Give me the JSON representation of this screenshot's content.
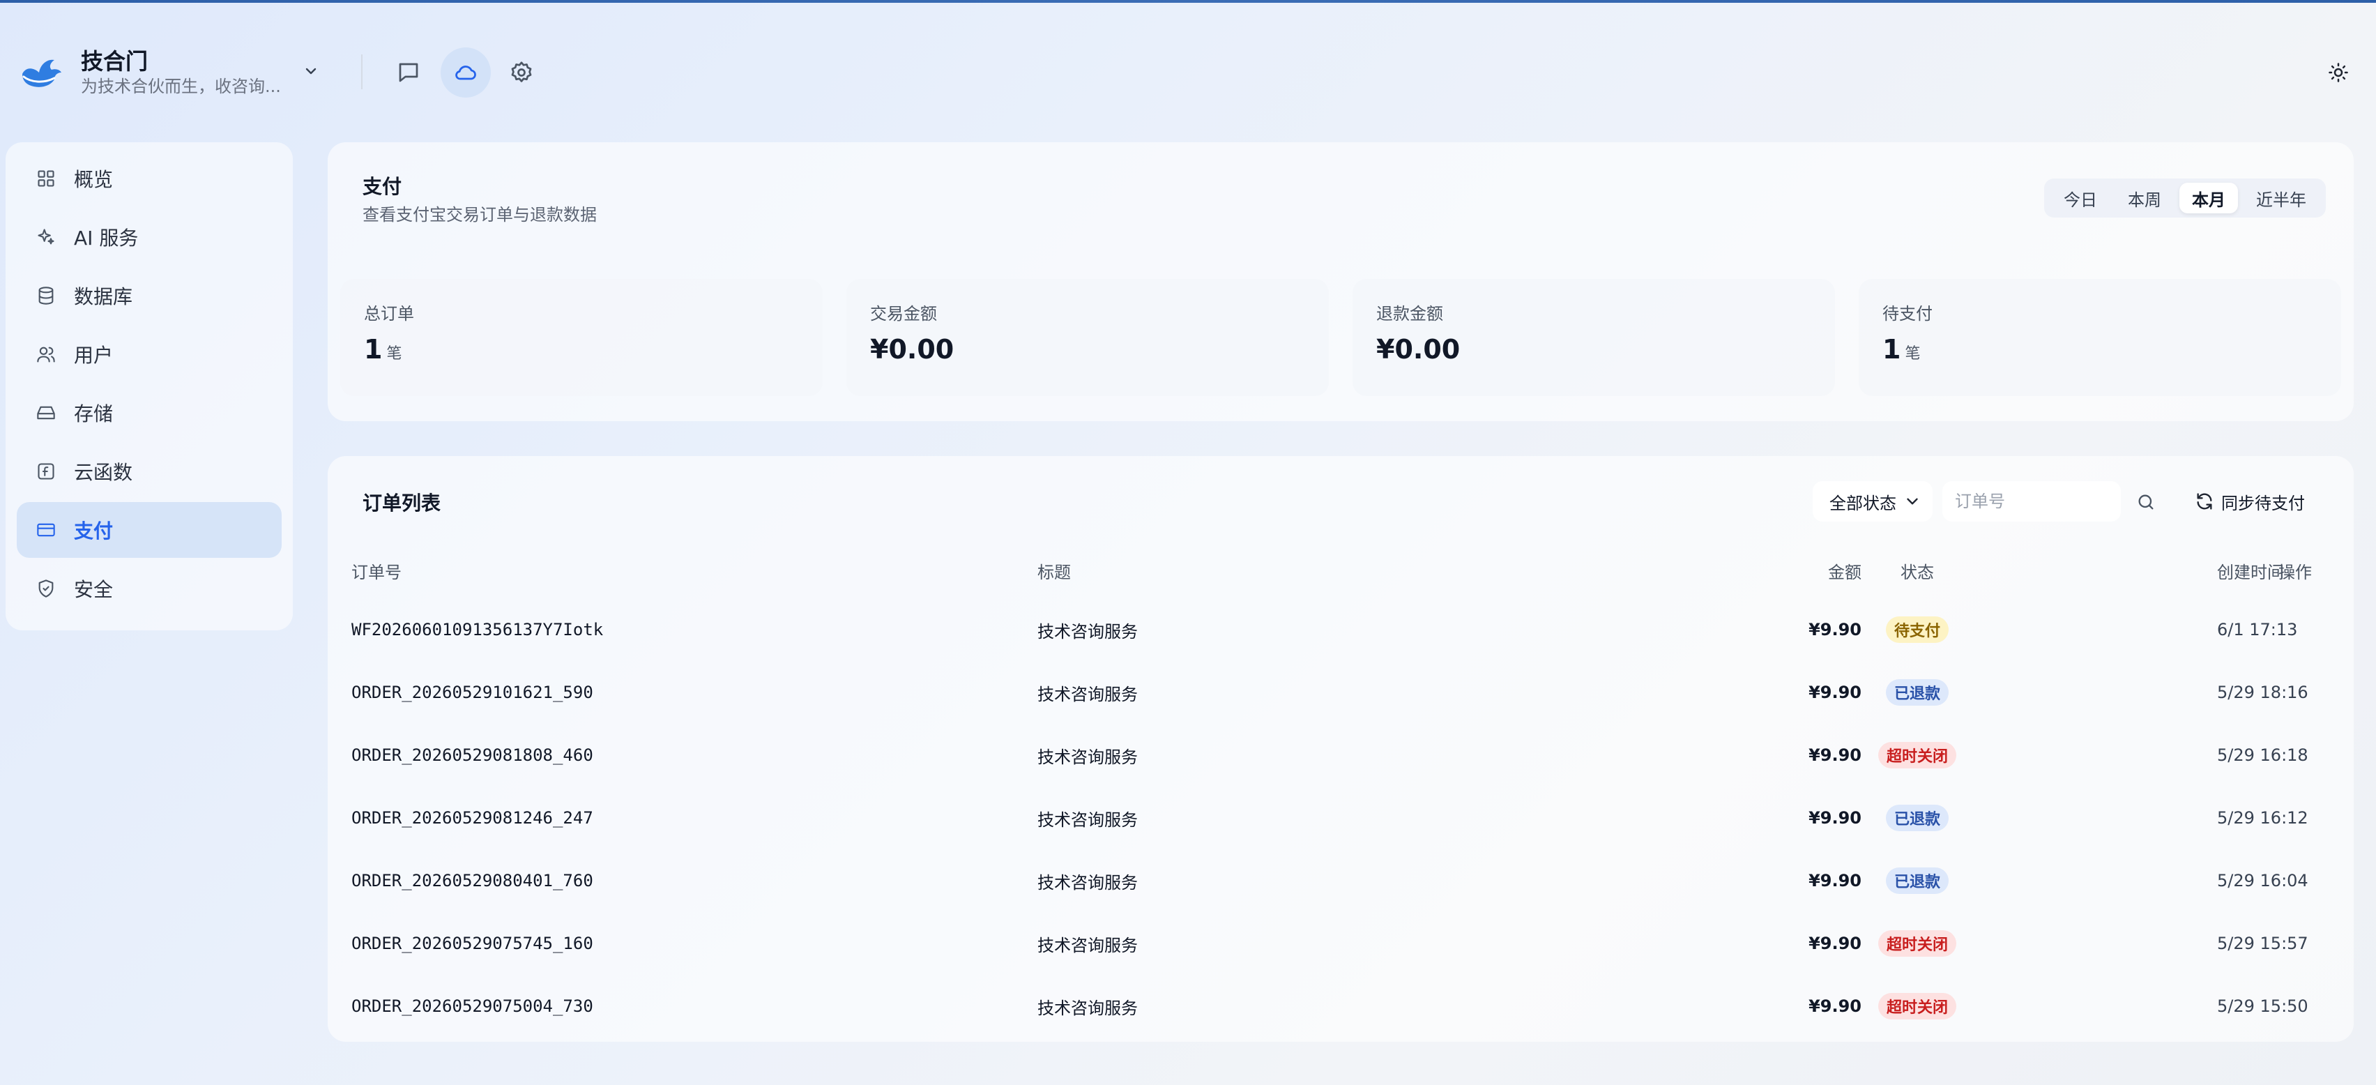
{
  "header": {
    "brand_name": "技合门",
    "brand_subtitle": "为技术合伙而生，收咨询...",
    "icons": {
      "chevron": "chevron-down-icon",
      "messages": "message-square-icon",
      "cloud": "cloud-icon",
      "settings": "gear-icon",
      "theme": "sun-icon"
    }
  },
  "sidebar": {
    "items": [
      {
        "label": "概览",
        "icon": "grid-icon"
      },
      {
        "label": "AI 服务",
        "icon": "sparkles-icon"
      },
      {
        "label": "数据库",
        "icon": "database-icon"
      },
      {
        "label": "用户",
        "icon": "users-icon"
      },
      {
        "label": "存储",
        "icon": "hard-drive-icon"
      },
      {
        "label": "云函数",
        "icon": "function-icon"
      },
      {
        "label": "支付",
        "icon": "credit-card-icon",
        "active": true
      },
      {
        "label": "安全",
        "icon": "shield-icon"
      }
    ]
  },
  "payment": {
    "title": "支付",
    "subtitle": "查看支付宝交易订单与退款数据",
    "ranges": [
      "今日",
      "本周",
      "本月",
      "近半年"
    ],
    "active_range": "本月",
    "stats": [
      {
        "label": "总订单",
        "value": "1",
        "unit": "笔"
      },
      {
        "label": "交易金额",
        "value": "¥0.00",
        "unit": ""
      },
      {
        "label": "退款金额",
        "value": "¥0.00",
        "unit": ""
      },
      {
        "label": "待支付",
        "value": "1",
        "unit": "笔"
      }
    ]
  },
  "orders": {
    "title": "订单列表",
    "status_filter": "全部状态",
    "search_placeholder": "订单号",
    "sync_label": "同步待支付",
    "columns": {
      "id": "订单号",
      "title": "标题",
      "amount": "金额",
      "status": "状态",
      "created": "创建时间",
      "actions": "操作"
    },
    "rows": [
      {
        "id": "WF20260601091356137Y7Iotk",
        "title": "技术咨询服务",
        "amount": "¥9.90",
        "status": "待支付",
        "status_kind": "pending",
        "created": "6/1 17:13"
      },
      {
        "id": "ORDER_20260529101621_590",
        "title": "技术咨询服务",
        "amount": "¥9.90",
        "status": "已退款",
        "status_kind": "refunded",
        "created": "5/29 18:16"
      },
      {
        "id": "ORDER_20260529081808_460",
        "title": "技术咨询服务",
        "amount": "¥9.90",
        "status": "超时关闭",
        "status_kind": "closed",
        "created": "5/29 16:18"
      },
      {
        "id": "ORDER_20260529081246_247",
        "title": "技术咨询服务",
        "amount": "¥9.90",
        "status": "已退款",
        "status_kind": "refunded",
        "created": "5/29 16:12"
      },
      {
        "id": "ORDER_20260529080401_760",
        "title": "技术咨询服务",
        "amount": "¥9.90",
        "status": "已退款",
        "status_kind": "refunded",
        "created": "5/29 16:04"
      },
      {
        "id": "ORDER_20260529075745_160",
        "title": "技术咨询服务",
        "amount": "¥9.90",
        "status": "超时关闭",
        "status_kind": "closed",
        "created": "5/29 15:57"
      },
      {
        "id": "ORDER_20260529075004_730",
        "title": "技术咨询服务",
        "amount": "¥9.90",
        "status": "超时关闭",
        "status_kind": "closed",
        "created": "5/29 15:50"
      }
    ]
  },
  "colors": {
    "accent": "#2563eb",
    "active_nav_bg": "#d6e4f8",
    "pending": "#8a6400",
    "refunded": "#2951a8",
    "closed": "#c81e1e"
  }
}
